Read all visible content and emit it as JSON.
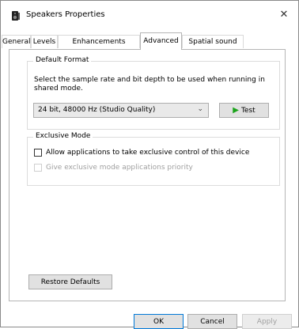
{
  "window": {
    "title": "Speakers Properties",
    "close_glyph": "✕",
    "icon": "speaker-icon"
  },
  "tabs": [
    {
      "label": "General",
      "active": false
    },
    {
      "label": "Levels",
      "active": false
    },
    {
      "label": "Enhancements",
      "active": false
    },
    {
      "label": "Advanced",
      "active": true
    },
    {
      "label": "Spatial sound",
      "active": false
    }
  ],
  "default_format": {
    "title": "Default Format",
    "description": "Select the sample rate and bit depth to be used when running in shared mode.",
    "selected": "24 bit, 48000 Hz (Studio Quality)",
    "test_label": "Test"
  },
  "exclusive_mode": {
    "title": "Exclusive Mode",
    "allow_label": "Allow applications to take exclusive control of this device",
    "allow_checked": false,
    "priority_label": "Give exclusive mode applications priority",
    "priority_checked": false,
    "priority_enabled": false
  },
  "restore_label": "Restore Defaults",
  "footer": {
    "ok_label": "OK",
    "cancel_label": "Cancel",
    "apply_label": "Apply",
    "apply_enabled": false
  },
  "colors": {
    "accent": "#0078d7",
    "test_arrow": "#1aa31a",
    "disabled_text": "#a0a0a0"
  }
}
